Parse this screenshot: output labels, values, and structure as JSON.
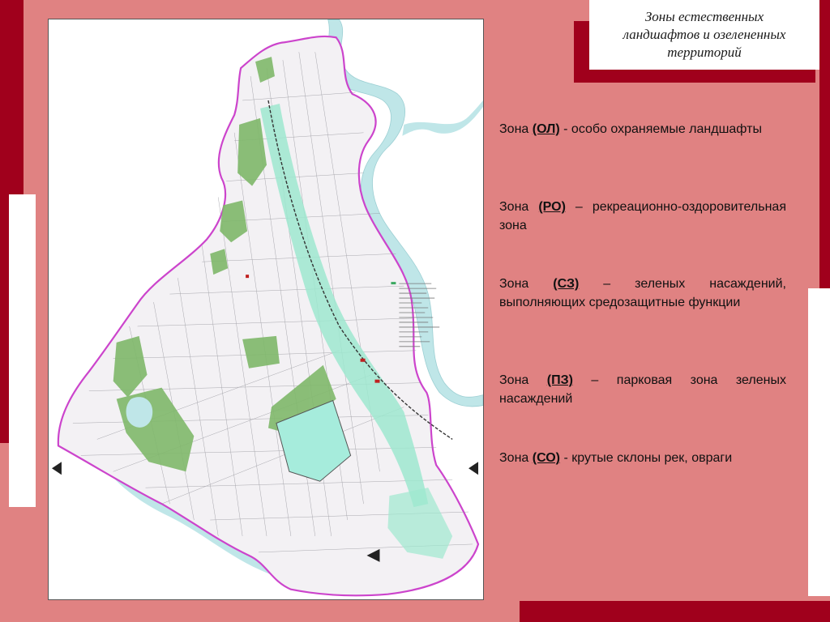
{
  "title_lines": [
    "Зоны естественных",
    "ландшафтов и озелененных",
    "территорий"
  ],
  "zones": [
    {
      "prefix": "Зона",
      "code": "(ОЛ)",
      "description": "- особо охраняемые ландшафты"
    },
    {
      "prefix": "Зона",
      "code": "(РО)",
      "description": "– рекреационно-оздоровительная зона"
    },
    {
      "prefix": "Зона",
      "code": "(СЗ)",
      "description": "– зеленых насаждений, выполняющих средозащитные функции"
    },
    {
      "prefix": "Зона",
      "code": "(ПЗ)",
      "description": "– парковая зона зеленых насаждений"
    },
    {
      "prefix": "Зона",
      "code": "(СО)",
      "description": "- крутые склоны рек, овраги"
    }
  ],
  "colors": {
    "background": "#e08282",
    "dark_red": "#a0001c",
    "boundary": "#cc44cc",
    "forest": "#7fb86a",
    "water": "#bfe6e8",
    "protective_zone": "#9ee8cf",
    "reservoir": "#a6ecdc"
  }
}
